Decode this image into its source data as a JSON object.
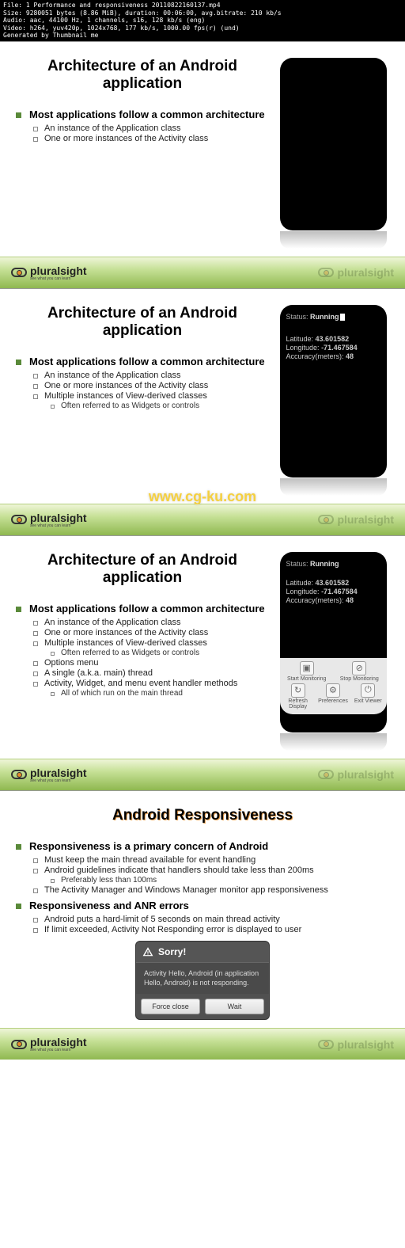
{
  "meta": {
    "line1": "File: 1 Performance and responsiveness 20110822160137.mp4",
    "line2": "Size: 9280051 bytes (8.86 MiB), duration: 00:06:00, avg.bitrate: 210 kb/s",
    "line3": "Audio: aac, 44100 Hz, 1 channels, s16, 128 kb/s (eng)",
    "line4": "Video: h264, yuv420p, 1024x768, 177 kb/s, 1000.00 fps(r) (und)",
    "line5": "Generated by Thumbnail me"
  },
  "brand": {
    "name": "pluralsight",
    "tagline": "see what you can learn"
  },
  "slide1": {
    "title": "Architecture of an Android application",
    "main": "Most applications follow a common architecture",
    "b1": "An instance of the Application class",
    "b2": "One or more instances of the Activity class"
  },
  "slide2": {
    "title": "Architecture of an Android application",
    "main": "Most applications follow a common architecture",
    "b1": "An instance of the Application class",
    "b2": "One or more instances of the Activity class",
    "b3": "Multiple instances of View-derived classes",
    "b3a": "Often referred to as Widgets or controls",
    "watermark": "www.cg-ku.com"
  },
  "slide3": {
    "title": "Architecture of an Android application",
    "main": "Most applications follow a common architecture",
    "b1": "An instance of the Application class",
    "b2": "One or more instances of the Activity class",
    "b3": "Multiple instances of View-derived classes",
    "b3a": "Often referred to as Widgets or controls",
    "b4": "Options menu",
    "b5": "A single (a.k.a. main) thread",
    "b6": "Activity, Widget, and menu event handler methods",
    "b6a": "All of which run on the main thread"
  },
  "slide4": {
    "title": "Android Responsiveness",
    "main1": "Responsiveness is a primary concern of Android",
    "b1": "Must keep the main thread available for event handling",
    "b2": "Android guidelines indicate that handlers should take less than 200ms",
    "b2a": "Preferably less than 100ms",
    "b3": "The Activity Manager and Windows Manager monitor app responsiveness",
    "main2": "Responsiveness and ANR errors",
    "b4": "Android puts a hard-limit of 5 seconds on main thread activity",
    "b5": "If limit exceeded, Activity Not Responding error is displayed to user"
  },
  "device": {
    "status_label": "Status:",
    "status_value": "Running",
    "lat_label": "Latitude:",
    "lat_value": "43.601582",
    "lon_label": "Longitude:",
    "lon_value": "-71.467584",
    "acc_label": "Accuracy(meters):",
    "acc_value": "48",
    "btn_start": "Start Monitoring",
    "btn_stop": "Stop Monitoring",
    "btn_refresh": "Refresh Display",
    "btn_prefs": "Preferences",
    "btn_exit": "Exit Viewer"
  },
  "dialog": {
    "title": "Sorry!",
    "body": "Activity Hello, Android (in application Hello, Android) is not responding.",
    "btn_close": "Force close",
    "btn_wait": "Wait"
  }
}
